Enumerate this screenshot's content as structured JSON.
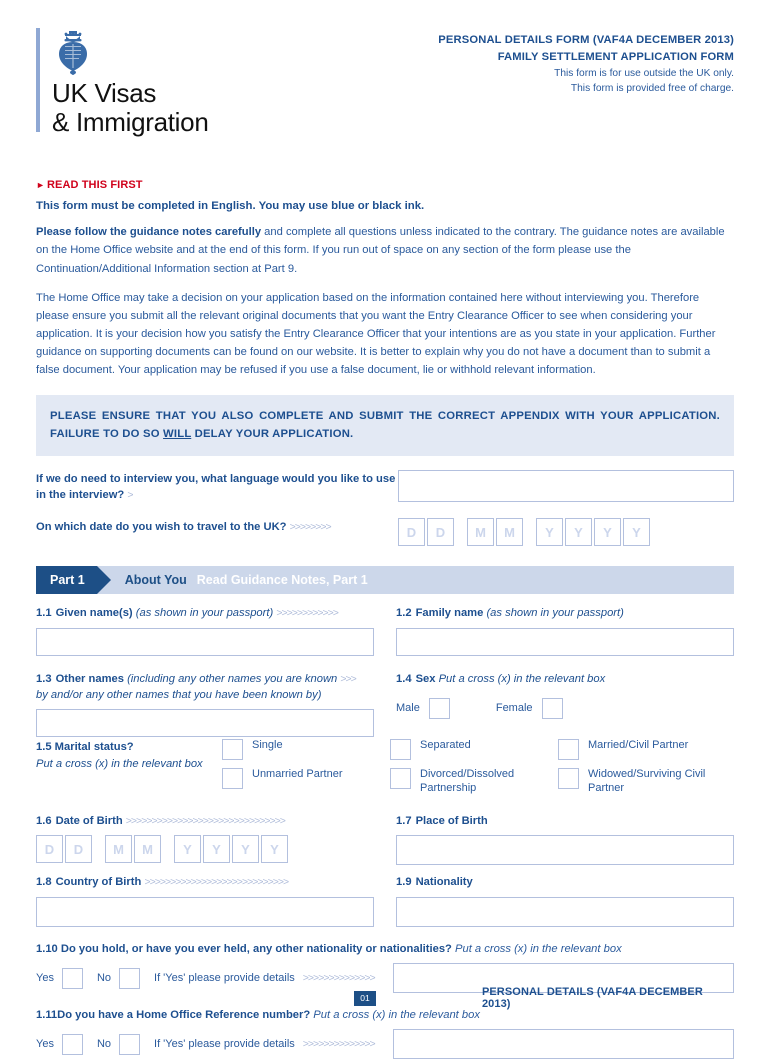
{
  "header": {
    "brand_name": "UK Visas\n& Immigration",
    "crest_alt": "royal-crest",
    "title_line1": "PERSONAL DETAILS FORM (VAF4A DECEMBER 2013)",
    "title_line2": "FAMILY SETTLEMENT APPLICATION FORM",
    "sub_line1": "This form is for use outside the UK only.",
    "sub_line2": "This form is provided free of charge."
  },
  "intro": {
    "read_first": "READ THIS FIRST",
    "lead": "This form must be completed in English. You may use blue or black ink.",
    "para1_bold": "Please follow the guidance notes carefully",
    "para1_rest": " and complete all questions unless indicated to the contrary. The guidance notes are available on the Home Office website and at the end of this form. If you run out of space on any section of the form please use the Continuation/Additional Information section at Part 9.",
    "para2": "The Home Office may take a decision on your application based on the information contained here without interviewing you. Therefore please ensure you submit all the relevant original documents that you want the Entry Clearance Officer to see when considering your application. It is your decision how you satisfy the Entry Clearance Officer that your intentions are as you state in your application. Further guidance on supporting documents can be found on our website. It is better to explain why you do not have a document than to submit a false document. Your application may be refused if you use a false document, lie or withhold relevant information.",
    "notice_part1": "PLEASE ENSURE THAT YOU ALSO COMPLETE AND SUBMIT THE CORRECT APPENDIX WITH YOUR APPLICATION. FAILURE TO DO SO ",
    "notice_underline": "WILL",
    "notice_part2": " DELAY YOUR APPLICATION."
  },
  "preamble": {
    "language_question": "If we do need to interview you, what language would you like to use in the interview?",
    "language_arrows": ">",
    "language_value": "",
    "travel_question": "On which date do you wish to travel to the UK?",
    "travel_arrows": ">>>>>>>>",
    "date_cells": [
      "D",
      "D",
      "M",
      "M",
      "Y",
      "Y",
      "Y",
      "Y"
    ]
  },
  "part": {
    "tab_label": "Part 1",
    "about_label": "About You",
    "guidance_label": "Read Guidance Notes, Part 1"
  },
  "questions": {
    "q11": {
      "num": "1.1",
      "label": "Given name(s)",
      "hint": "(as shown in your passport)",
      "arrows": ">>>>>>>>>>>>",
      "value": ""
    },
    "q12": {
      "num": "1.2",
      "label": "Family name",
      "hint": "(as shown in your passport)",
      "value": ""
    },
    "q13": {
      "num": "1.3",
      "label": "Other names",
      "hint_line1": "(including any other names you are known",
      "hint_line2": "by and/or any other names that you have been known by)",
      "arrows": ">>>",
      "value": ""
    },
    "q14": {
      "num": "1.4",
      "label": "Sex",
      "hint": "Put a cross (x) in the relevant box",
      "option_male": "Male",
      "option_female": "Female"
    },
    "q15": {
      "num": "1.5",
      "label": "Marital status?",
      "hint": "Put a cross (x) in the relevant box",
      "options": [
        "Single",
        "Unmarried Partner",
        "Separated",
        "Divorced/Dissolved Partnership",
        "Married/Civil Partner",
        "Widowed/Surviving Civil Partner"
      ]
    },
    "q16": {
      "num": "1.6",
      "label": "Date of Birth",
      "arrows": ">>>>>>>>>>>>>>>>>>>>>>>>>>>>>>>",
      "date_cells": [
        "D",
        "D",
        "M",
        "M",
        "Y",
        "Y",
        "Y",
        "Y"
      ]
    },
    "q17": {
      "num": "1.7",
      "label": "Place of Birth",
      "value": ""
    },
    "q18": {
      "num": "1.8",
      "label": "Country of Birth",
      "arrows": ">>>>>>>>>>>>>>>>>>>>>>>>>>>>",
      "value": ""
    },
    "q19": {
      "num": "1.9",
      "label": "Nationality",
      "value": ""
    },
    "q110": {
      "num": "1.10",
      "label": "Do you hold, or have you ever held, any other nationality or nationalities?",
      "hint": "Put a cross (x) in the relevant box",
      "yes_label": "Yes",
      "no_label": "No",
      "detail_label": "If 'Yes' please provide details",
      "detail_arrows": ">>>>>>>>>>>>>>",
      "value": ""
    },
    "q111": {
      "num": "1.11",
      "label": "Do you have a Home Office Reference number?",
      "hint": "Put a cross (x) in the relevant box",
      "yes_label": "Yes",
      "no_label": "No",
      "detail_label": "If 'Yes' please provide details",
      "detail_arrows": ">>>>>>>>>>>>>>",
      "value": ""
    }
  },
  "footer": {
    "page_number": "01",
    "title": "PERSONAL DETAILS (VAF4A DECEMBER 2013)"
  },
  "colors": {
    "brand_blue": "#1d4f8f",
    "dark_navy": "#1d4f86",
    "red": "#d0021b",
    "notice_bg": "#e3e9f4",
    "bar_bg": "#ccd7ea",
    "field_border": "#b3c0de",
    "arrow_grey": "#aebbd9"
  }
}
